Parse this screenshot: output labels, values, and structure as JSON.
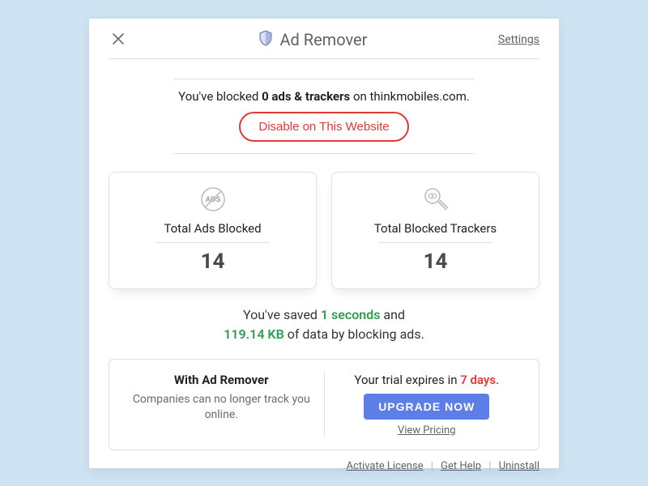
{
  "header": {
    "title": "Ad Remover",
    "settings_label": "Settings"
  },
  "summary": {
    "prefix": "You've blocked ",
    "count_text": "0 ads & trackers",
    "middle": " on ",
    "domain": "thinkmobiles.com",
    "suffix": ".",
    "disable_label": "Disable on This Website"
  },
  "stats": {
    "ads": {
      "label": "Total Ads Blocked",
      "value": "14"
    },
    "trackers": {
      "label": "Total Blocked Trackers",
      "value": "14"
    }
  },
  "savings": {
    "line1_prefix": "You've saved ",
    "time_value": "1 seconds",
    "line1_suffix": " and",
    "line2_data": "119.14 KB",
    "line2_suffix": " of data by blocking ads."
  },
  "trial": {
    "left_title": "With Ad Remover",
    "left_sub": "Companies can no longer track you online.",
    "expire_prefix": "Your trial expires in ",
    "expire_days": "7 days",
    "expire_suffix": ".",
    "upgrade_label": "UPGRADE NOW",
    "view_pricing_label": "View Pricing"
  },
  "footer": {
    "activate": "Activate License",
    "help": "Get Help",
    "uninstall": "Uninstall"
  }
}
